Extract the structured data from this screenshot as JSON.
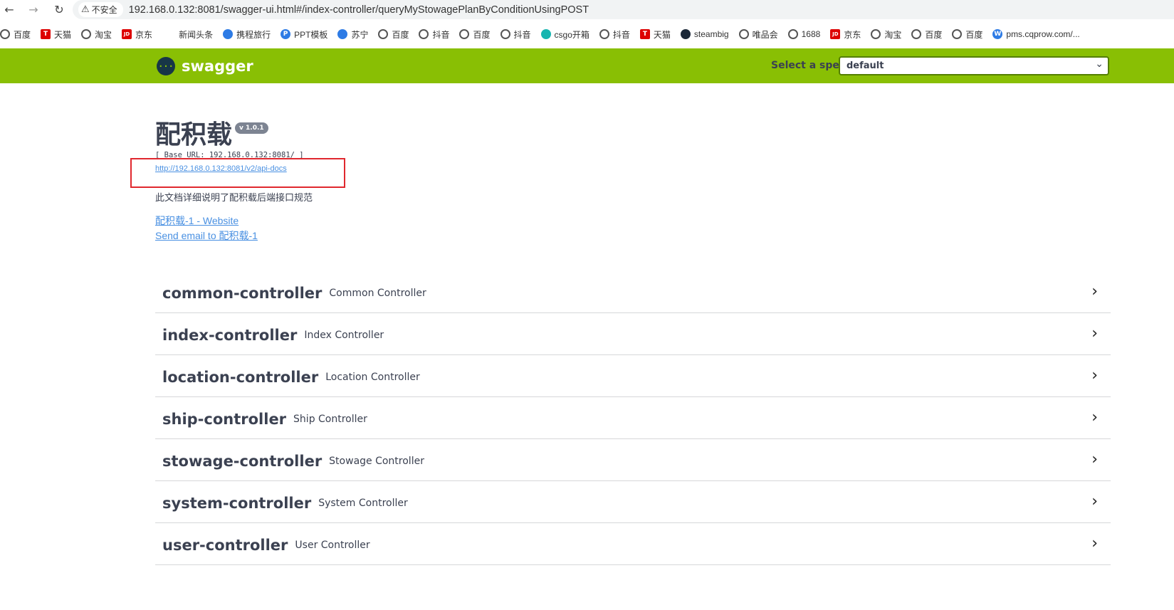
{
  "browser": {
    "security_label": "不安全",
    "url": "192.168.0.132:8081/swagger-ui.html#/index-controller/queryMyStowagePlanByConditionUsingPOST"
  },
  "bookmarks": [
    {
      "label": "百度",
      "icon": "globe-icon"
    },
    {
      "label": "天猫",
      "icon": "tmall-icon"
    },
    {
      "label": "淘宝",
      "icon": "globe-icon"
    },
    {
      "label": "京东",
      "icon": "jd-icon"
    },
    {
      "label": "新闻头条",
      "icon": "none"
    },
    {
      "label": "携程旅行",
      "icon": "ctrip-icon"
    },
    {
      "label": "PPT模板",
      "icon": "ppt-icon"
    },
    {
      "label": "苏宁",
      "icon": "suning-icon"
    },
    {
      "label": "百度",
      "icon": "globe-icon"
    },
    {
      "label": "抖音",
      "icon": "globe-icon"
    },
    {
      "label": "百度",
      "icon": "globe-icon"
    },
    {
      "label": "抖音",
      "icon": "globe-icon"
    },
    {
      "label": "csgo开箱",
      "icon": "csgo-icon"
    },
    {
      "label": "抖音",
      "icon": "globe-icon"
    },
    {
      "label": "天猫",
      "icon": "tmall-icon"
    },
    {
      "label": "steambig",
      "icon": "steam-icon"
    },
    {
      "label": "唯品会",
      "icon": "globe-icon"
    },
    {
      "label": "1688",
      "icon": "globe-icon"
    },
    {
      "label": "京东",
      "icon": "jd-icon"
    },
    {
      "label": "淘宝",
      "icon": "globe-icon"
    },
    {
      "label": "百度",
      "icon": "globe-icon"
    },
    {
      "label": "百度",
      "icon": "globe-icon"
    },
    {
      "label": "pms.cqprow.com/...",
      "icon": "pms-icon"
    }
  ],
  "topbar": {
    "logo_text": "swagger",
    "logo_glyph": "{···}",
    "spec_label": "Select a spec",
    "spec_value": "default",
    "color": "#89bf04"
  },
  "info": {
    "title": "配积载",
    "version": "v 1.0.1",
    "base_url": "[ Base URL: 192.168.0.132:8081/ ]",
    "api_docs_link": "http://192.168.0.132:8081/v2/api-docs",
    "description": "此文档详细说明了配积载后端接口规范",
    "website_link": "配积载-1 - Website",
    "email_link": "Send email to 配积载-1"
  },
  "controllers": [
    {
      "name": "common-controller",
      "desc": "Common Controller"
    },
    {
      "name": "index-controller",
      "desc": "Index Controller"
    },
    {
      "name": "location-controller",
      "desc": "Location Controller"
    },
    {
      "name": "ship-controller",
      "desc": "Ship Controller"
    },
    {
      "name": "stowage-controller",
      "desc": "Stowage Controller"
    },
    {
      "name": "system-controller",
      "desc": "System Controller"
    },
    {
      "name": "user-controller",
      "desc": "User Controller"
    }
  ]
}
